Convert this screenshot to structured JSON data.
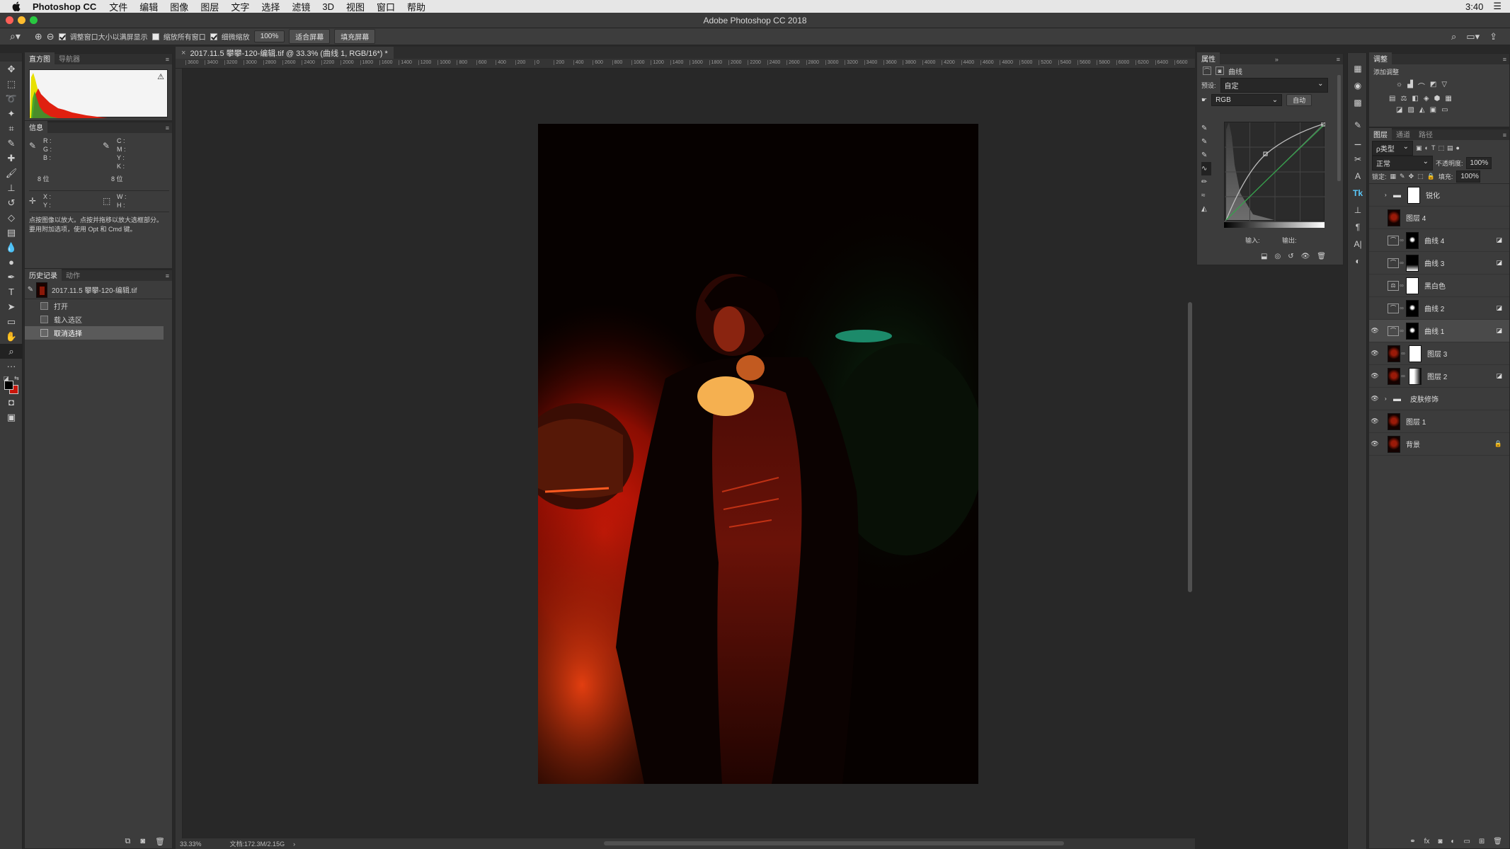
{
  "menubar": {
    "app": "Photoshop CC",
    "items": [
      "文件",
      "编辑",
      "图像",
      "图层",
      "文字",
      "选择",
      "滤镜",
      "3D",
      "视图",
      "窗口",
      "帮助"
    ],
    "time": "3:40"
  },
  "window": {
    "title": "Adobe Photoshop CC 2018"
  },
  "options": {
    "resize_windows": "调整窗口大小以满屏显示",
    "zoom_all": "缩放所有窗口",
    "scrubby": "细微缩放",
    "zoom_value": "100%",
    "fit_screen": "适合屏幕",
    "fill_screen": "填充屏幕"
  },
  "histogram": {
    "tabs": [
      "直方图",
      "导航器"
    ]
  },
  "info": {
    "tab": "信息",
    "rgb_labels": [
      "R :",
      "G :",
      "B :"
    ],
    "cmyk_labels": [
      "C :",
      "M :",
      "Y :",
      "K :"
    ],
    "bit_left": "8 位",
    "bit_right": "8 位",
    "xy": [
      "X :",
      "Y :"
    ],
    "wh": [
      "W :",
      "H :"
    ],
    "hint": "点按图像以放大。点按并拖移以放大选框部分。要用附加选项，使用 Opt 和 Cmd 键。"
  },
  "history": {
    "tabs": [
      "历史记录",
      "动作"
    ],
    "snapshot": "2017.11.5 攀攀-120-编辑.tif",
    "steps": [
      "打开",
      "载入选区",
      "取消选择"
    ]
  },
  "document": {
    "tab_title": "2017.11.5 攀攀-120-编辑.tif @ 33.3% (曲线 1, RGB/16*) *",
    "ruler_left": [
      "3600",
      "3400",
      "3200",
      "3000",
      "2800",
      "2600",
      "2400",
      "2200",
      "2000",
      "1800",
      "1600",
      "1400",
      "1200",
      "1000",
      "800",
      "600",
      "400",
      "200"
    ],
    "ruler_right": [
      "0",
      "200",
      "400",
      "600",
      "800",
      "1000",
      "1200",
      "1400",
      "1600",
      "1800",
      "2000",
      "2200",
      "2400",
      "2600",
      "2800",
      "3000",
      "3200",
      "3400",
      "3600",
      "3800",
      "4000",
      "4200",
      "4400",
      "4600",
      "4800",
      "5000",
      "5200",
      "5400",
      "5600",
      "5800",
      "6000",
      "6200",
      "6400",
      "6600"
    ],
    "zoom": "33.33%",
    "doc_size": "文档:172.3M/2.15G"
  },
  "properties": {
    "tab": "属性",
    "title": "曲线",
    "preset_label": "预设:",
    "preset_value": "自定",
    "channel": "RGB",
    "auto": "自动",
    "input_label": "输入:",
    "output_label": "输出:"
  },
  "adjustments": {
    "tab": "调整",
    "add": "添加调整"
  },
  "layers": {
    "tabs": [
      "图层",
      "通道",
      "路径"
    ],
    "filter_kind": "ρ类型",
    "blend_mode": "正常",
    "opacity_label": "不透明度:",
    "opacity": "100%",
    "lock_label": "锁定:",
    "fill_label": "填充:",
    "fill": "100%",
    "items": [
      {
        "name": "锐化",
        "kind": "group",
        "visible": false
      },
      {
        "name": "图层 4",
        "kind": "pixel",
        "visible": false
      },
      {
        "name": "曲线 4",
        "kind": "curves",
        "visible": false
      },
      {
        "name": "曲线 3",
        "kind": "curves",
        "visible": false
      },
      {
        "name": "黑白色",
        "kind": "bw",
        "visible": false
      },
      {
        "name": "曲线 2",
        "kind": "curves",
        "visible": false
      },
      {
        "name": "曲线 1",
        "kind": "curves",
        "visible": true,
        "selected": true
      },
      {
        "name": "图层 3",
        "kind": "pixel",
        "visible": true
      },
      {
        "name": "图层 2",
        "kind": "pixel",
        "visible": true
      },
      {
        "name": "皮肤修饰",
        "kind": "group",
        "visible": true
      },
      {
        "name": "图层 1",
        "kind": "pixel",
        "visible": true
      },
      {
        "name": "背景",
        "kind": "pixel",
        "visible": true
      }
    ]
  },
  "colors": {
    "bg": "#282828",
    "panel": "#3c3c3c",
    "accent_red": "#c8150a"
  }
}
